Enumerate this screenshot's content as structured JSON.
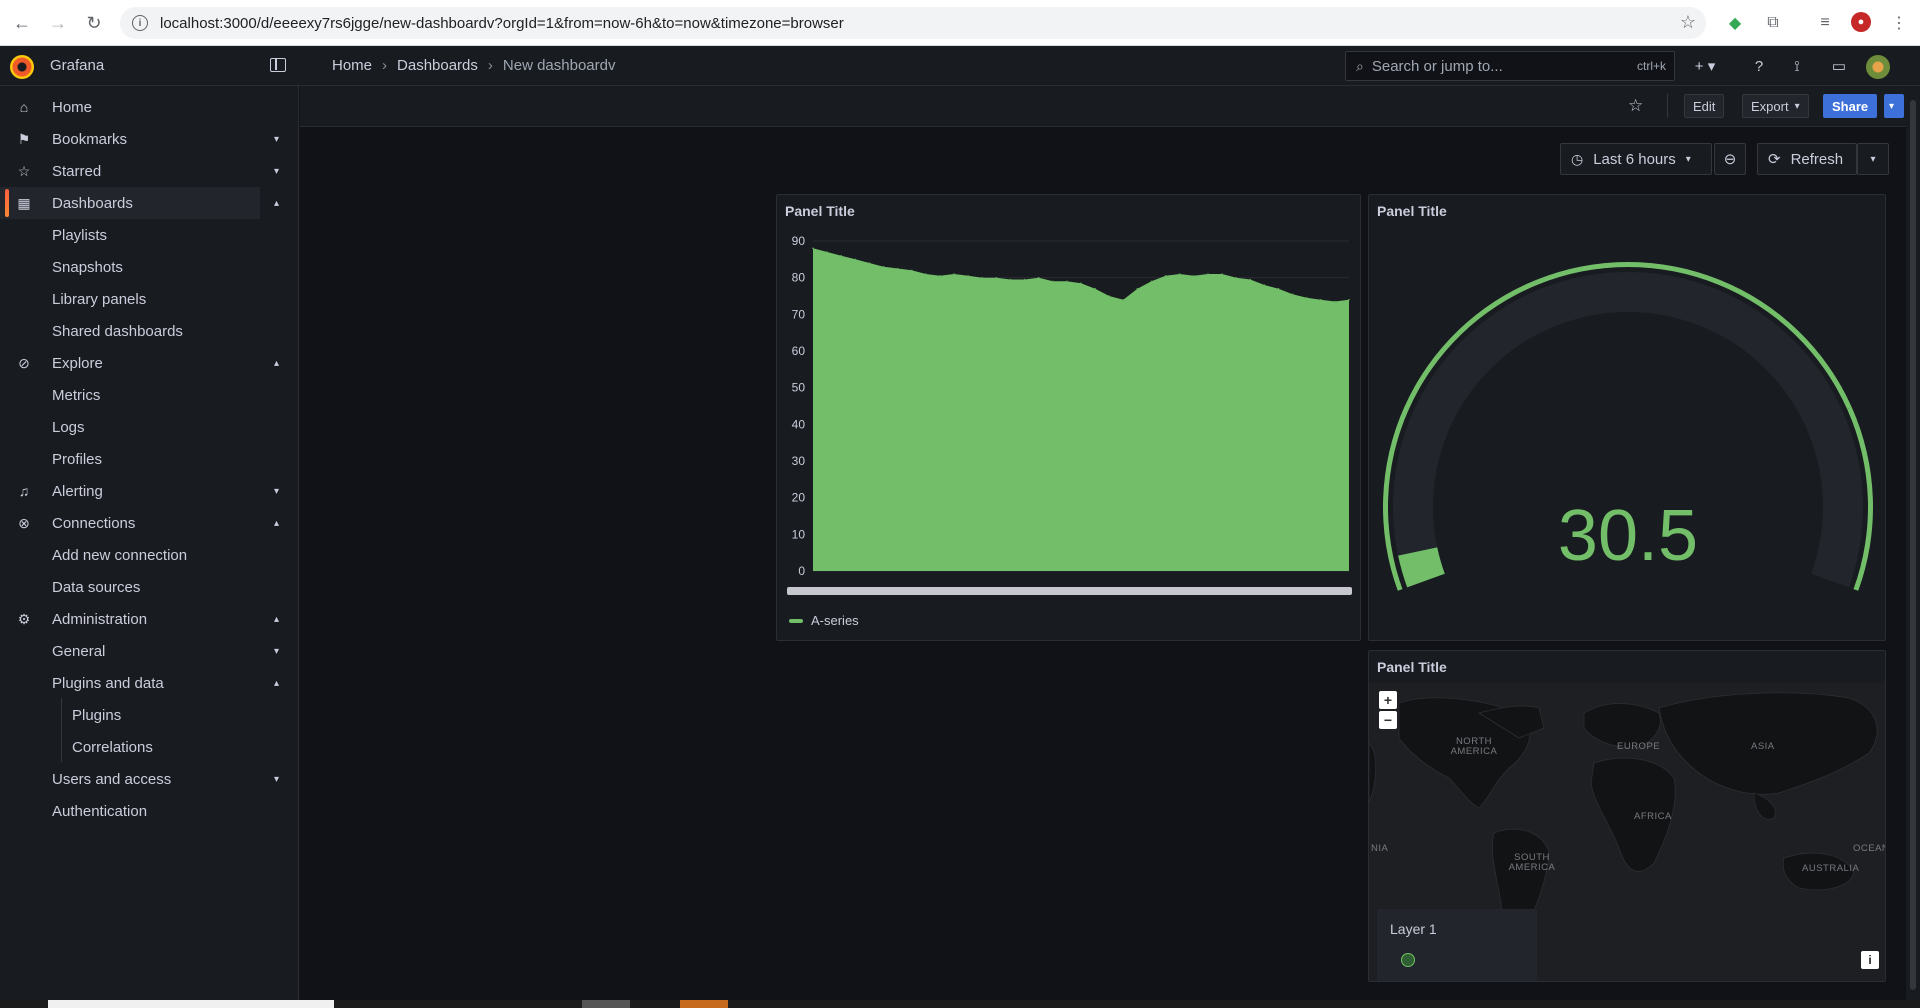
{
  "browser": {
    "url": "localhost:3000/d/eeeexy7rs6jgge/new-dashboardv?orgId=1&from=now-6h&to=now&timezone=browser"
  },
  "topnav": {
    "brand": "Grafana",
    "breadcrumb": [
      "Home",
      "Dashboards",
      "New dashboardv"
    ],
    "search_placeholder": "Search or jump to...",
    "search_shortcut": "ctrl+k"
  },
  "sidebar": {
    "items": [
      {
        "label": "Home",
        "icon": "home-icon"
      },
      {
        "label": "Bookmarks",
        "icon": "bookmark-icon",
        "chevron": "down"
      },
      {
        "label": "Starred",
        "icon": "star-icon",
        "chevron": "down"
      },
      {
        "label": "Dashboards",
        "icon": "apps-icon",
        "chevron": "up",
        "active": true
      },
      {
        "label": "Playlists"
      },
      {
        "label": "Snapshots"
      },
      {
        "label": "Library panels"
      },
      {
        "label": "Shared dashboards"
      },
      {
        "label": "Explore",
        "icon": "compass-icon",
        "chevron": "up"
      },
      {
        "label": "Metrics"
      },
      {
        "label": "Logs"
      },
      {
        "label": "Profiles"
      },
      {
        "label": "Alerting",
        "icon": "bell-icon",
        "chevron": "down"
      },
      {
        "label": "Connections",
        "icon": "link-icon",
        "chevron": "up"
      },
      {
        "label": "Add new connection"
      },
      {
        "label": "Data sources"
      },
      {
        "label": "Administration",
        "icon": "cog-icon",
        "chevron": "up"
      },
      {
        "label": "General",
        "chevron": "down"
      },
      {
        "label": "Plugins and data",
        "chevron": "up"
      },
      {
        "label": "Plugins"
      },
      {
        "label": "Correlations"
      },
      {
        "label": "Users and access",
        "chevron": "down"
      },
      {
        "label": "Authentication"
      }
    ]
  },
  "toolbar": {
    "edit": "Edit",
    "export": "Export",
    "share": "Share"
  },
  "time": {
    "range": "Last 6 hours",
    "refresh": "Refresh"
  },
  "panels": {
    "timeseries": {
      "title": "Panel Title",
      "legend": "A-series"
    },
    "gauge": {
      "title": "Panel Title",
      "value": "30.5",
      "fraction": 0.305,
      "threshold_red_fraction": 0.8,
      "color": "#73bf69"
    },
    "geomap": {
      "title": "Panel Title",
      "layer_title": "Layer 1",
      "zoom_in": "+",
      "zoom_out": "−",
      "info": "i",
      "labels": [
        "NORTH AMERICA",
        "EUROPE",
        "ASIA",
        "AFRICA",
        "SOUTH AMERICA",
        "AUSTRALIA",
        "OCEAN",
        "NIA"
      ]
    }
  },
  "chart_data": {
    "type": "area",
    "series": [
      {
        "name": "A-series",
        "values": [
          88,
          87,
          86,
          85,
          84,
          83,
          82.5,
          82,
          81,
          80.5,
          81,
          80.5,
          80,
          80,
          79.5,
          79.5,
          80,
          79,
          79,
          78.5,
          77,
          75,
          74,
          77,
          79,
          80.5,
          81,
          80.5,
          81,
          81,
          80,
          79.5,
          78,
          77,
          75.5,
          74.5,
          74,
          73.5,
          74
        ]
      }
    ],
    "ylim": [
      0,
      90
    ],
    "yticks": [
      0,
      10,
      20,
      30,
      40,
      50,
      60,
      70,
      80,
      90
    ],
    "color": "#73bf69",
    "grid": true,
    "legend": "bottom-left"
  }
}
